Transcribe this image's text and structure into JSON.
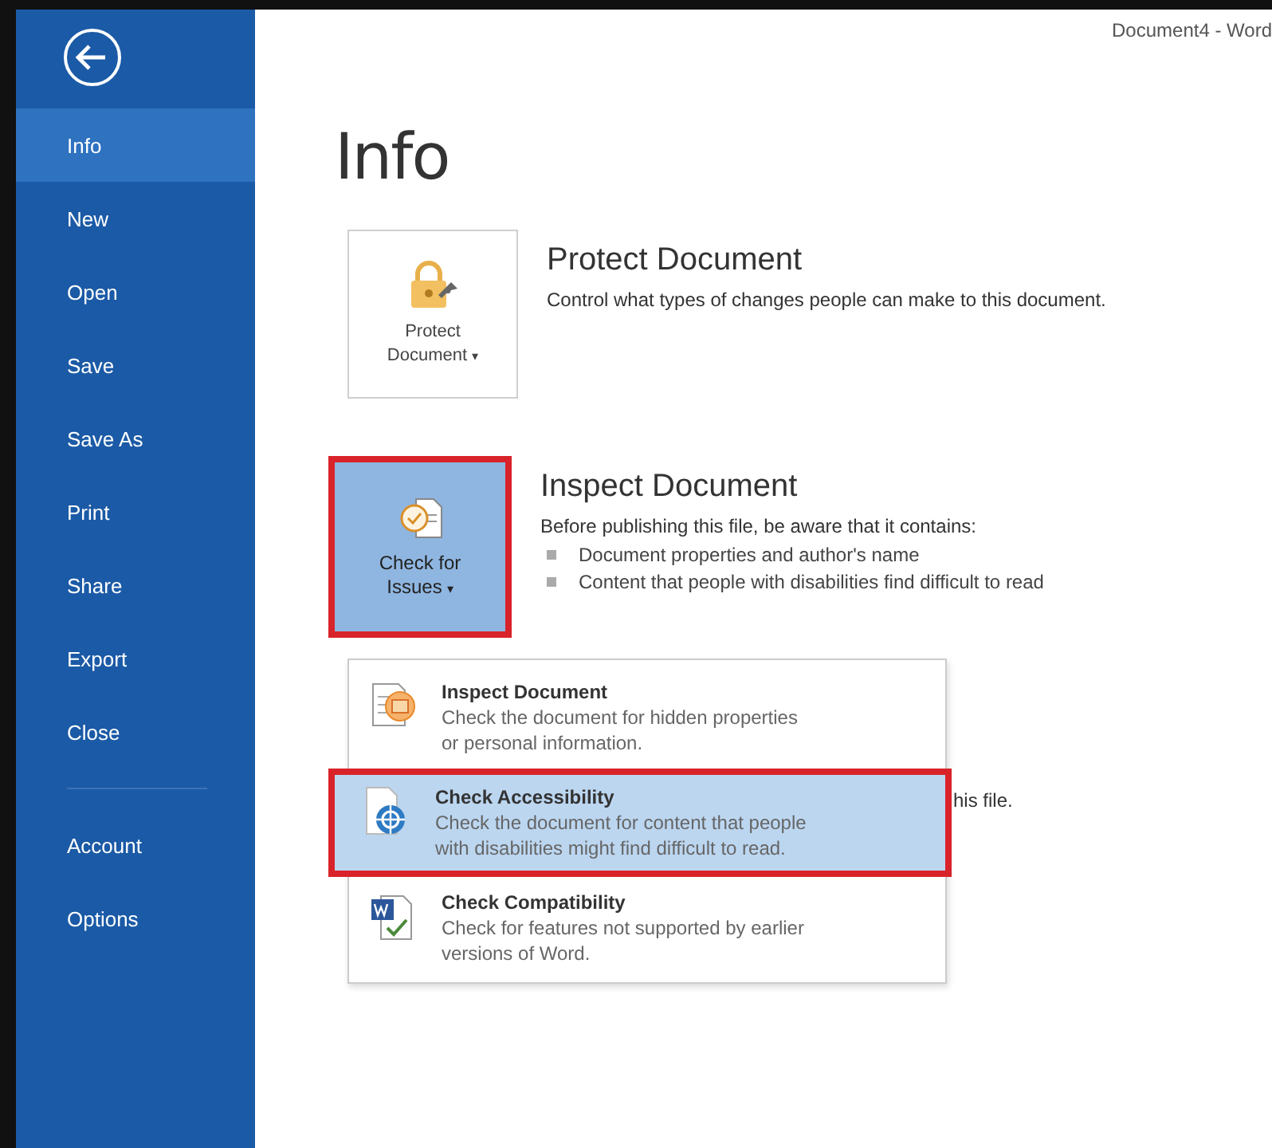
{
  "window": {
    "title": "Document4 - Word"
  },
  "sidebar": {
    "items": [
      {
        "label": "Info",
        "selected": true
      },
      {
        "label": "New",
        "selected": false
      },
      {
        "label": "Open",
        "selected": false
      },
      {
        "label": "Save",
        "selected": false
      },
      {
        "label": "Save As",
        "selected": false
      },
      {
        "label": "Print",
        "selected": false
      },
      {
        "label": "Share",
        "selected": false
      },
      {
        "label": "Export",
        "selected": false
      },
      {
        "label": "Close",
        "selected": false
      },
      {
        "label": "Account",
        "selected": false
      },
      {
        "label": "Options",
        "selected": false
      }
    ]
  },
  "page_title": "Info",
  "sections": [
    {
      "kind": "protect",
      "button": {
        "label_lines": [
          "Protect",
          "Document"
        ],
        "caret": "▾",
        "highlighted": false
      },
      "title": "Protect Document",
      "description": "Control what types of changes people can make to this document."
    },
    {
      "kind": "inspect",
      "button": {
        "label_lines": [
          "Check for",
          "Issues"
        ],
        "caret": "▾",
        "highlighted": true
      },
      "title": "Inspect Document",
      "description": "Before publishing this file, be aware that it contains:",
      "bullets": [
        "Document properties and author's name",
        "Content that people with disabilities find difficult to read"
      ]
    }
  ],
  "hidden_text": "his file.",
  "dropdown": {
    "items": [
      {
        "kind": "inspect",
        "title": "Inspect Document",
        "description_lines": [
          "Check the document for hidden properties",
          "or personal information."
        ],
        "selected": false,
        "highlighted": false
      },
      {
        "kind": "accessibility",
        "title": "Check Accessibility",
        "description_lines": [
          "Check the document for content that people",
          "with disabilities might find difficult to read."
        ],
        "selected": true,
        "highlighted": true
      },
      {
        "kind": "compatibility",
        "title": "Check Compatibility",
        "description_lines": [
          "Check for features not supported by earlier",
          "versions of Word."
        ],
        "selected": false,
        "highlighted": false
      }
    ]
  }
}
